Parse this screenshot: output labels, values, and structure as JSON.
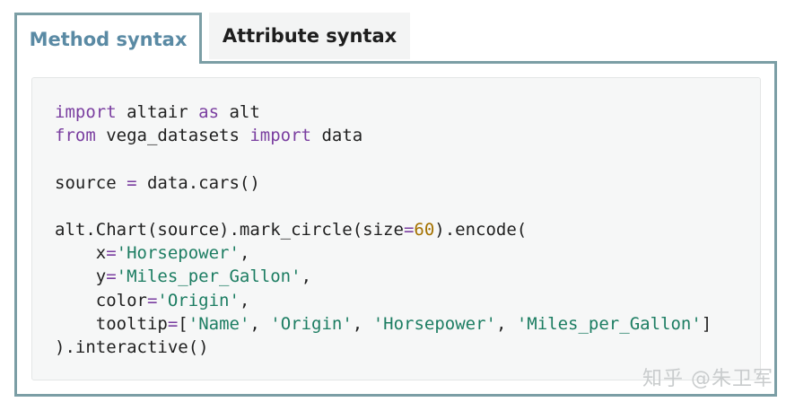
{
  "tabs": [
    {
      "label": "Method syntax",
      "active": true
    },
    {
      "label": "Attribute syntax",
      "active": false
    }
  ],
  "code": {
    "language": "python",
    "lines": [
      [
        {
          "t": "import",
          "c": "kw"
        },
        {
          "t": " altair ",
          "c": ""
        },
        {
          "t": "as",
          "c": "kw"
        },
        {
          "t": " alt",
          "c": ""
        }
      ],
      [
        {
          "t": "from",
          "c": "kw"
        },
        {
          "t": " vega_datasets ",
          "c": ""
        },
        {
          "t": "import",
          "c": "kw"
        },
        {
          "t": " data",
          "c": ""
        }
      ],
      [],
      [
        {
          "t": "source ",
          "c": ""
        },
        {
          "t": "=",
          "c": "op"
        },
        {
          "t": " data.cars()",
          "c": ""
        }
      ],
      [],
      [
        {
          "t": "alt.Chart(source).mark_circle(size",
          "c": ""
        },
        {
          "t": "=",
          "c": "op"
        },
        {
          "t": "60",
          "c": "num"
        },
        {
          "t": ").encode(",
          "c": ""
        }
      ],
      [
        {
          "t": "    x",
          "c": ""
        },
        {
          "t": "=",
          "c": "op"
        },
        {
          "t": "'Horsepower'",
          "c": "str"
        },
        {
          "t": ",",
          "c": ""
        }
      ],
      [
        {
          "t": "    y",
          "c": ""
        },
        {
          "t": "=",
          "c": "op"
        },
        {
          "t": "'Miles_per_Gallon'",
          "c": "str"
        },
        {
          "t": ",",
          "c": ""
        }
      ],
      [
        {
          "t": "    color",
          "c": ""
        },
        {
          "t": "=",
          "c": "op"
        },
        {
          "t": "'Origin'",
          "c": "str"
        },
        {
          "t": ",",
          "c": ""
        }
      ],
      [
        {
          "t": "    tooltip",
          "c": ""
        },
        {
          "t": "=",
          "c": "op"
        },
        {
          "t": "[",
          "c": ""
        },
        {
          "t": "'Name'",
          "c": "str"
        },
        {
          "t": ", ",
          "c": ""
        },
        {
          "t": "'Origin'",
          "c": "str"
        },
        {
          "t": ", ",
          "c": ""
        },
        {
          "t": "'Horsepower'",
          "c": "str"
        },
        {
          "t": ", ",
          "c": ""
        },
        {
          "t": "'Miles_per_Gallon'",
          "c": "str"
        },
        {
          "t": "]",
          "c": ""
        }
      ],
      [
        {
          "t": ").interactive()",
          "c": ""
        }
      ]
    ]
  },
  "watermark": "知乎 @朱卫军",
  "colors": {
    "tab_border": "#7b9ea5",
    "active_tab_text": "#5a8aa4",
    "keyword": "#7a3ea0",
    "string": "#1c7d62",
    "number": "#a47200",
    "code_bg": "#f6f7f7"
  }
}
